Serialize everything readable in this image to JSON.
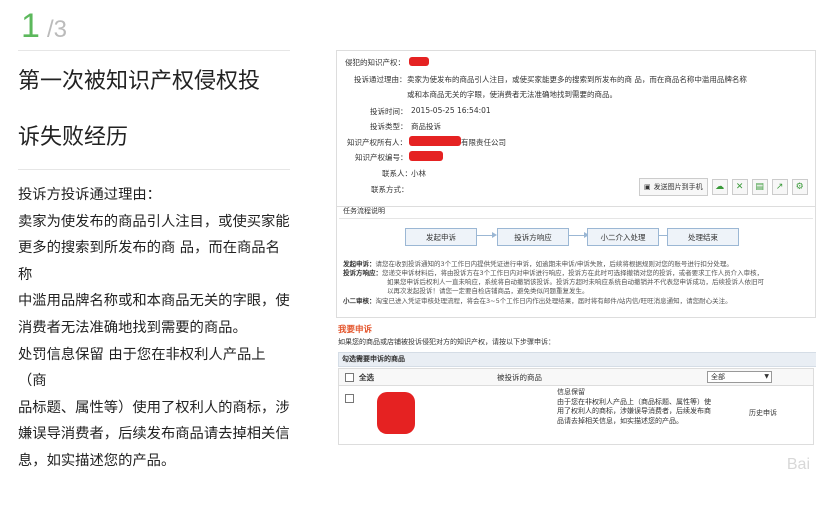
{
  "step": {
    "current": "1",
    "total": "/3"
  },
  "title_line1": "第一次被知识产权侵权投",
  "title_line2": "诉失败经历",
  "body": [
    "投诉方投诉通过理由：",
    "卖家为使发布的商品引人注目，或使买家能",
    "更多的搜索到所发布的商 品，而在商品名称",
    "中滥用品牌名称或和本商品无关的字眼，使",
    "消费者无法准确地找到需要的商品。",
    "处罚信息保留 由于您在非权利人产品上（商",
    "品标题、属性等）使用了权利人的商标，涉",
    "嫌误导消费者，后续发布商品请去掉相关信",
    "息，如实描述您的产品。"
  ],
  "screenshot": {
    "ip_label": "侵犯的知识产权：",
    "reason_label": "投诉通过理由：",
    "reason_line1": "卖家为使发布的商品引人注目，或使买家能更多的搜索到所发布的商 品，而在商品名称中滥用品牌名称",
    "reason_line2": "或和本商品无关的字眼，使消费者无法准确地找到需要的商品。",
    "time_label": "投诉时间：",
    "time_value": "2015-05-25 16:54:01",
    "type_label": "投诉类型：",
    "type_value": "商品投诉",
    "owner_label": "知识产权所有人：",
    "owner_suffix": "有限责任公司",
    "ipno_label": "知识产权编号：",
    "contact_label": "联系人：",
    "contact_value": "小林",
    "contact_way_label": "联系方式：",
    "send_phone": "发送图片到手机",
    "flow_title": "任务流程说明",
    "flow_steps": [
      "发起申诉",
      "投诉方响应",
      "小二介入处理",
      "处理结束"
    ],
    "desc1_label": "发起申诉：",
    "desc1_text": "请您在收到投诉通知的3个工作日内提供凭证进行申诉，如逾期未申诉/申诉失败，后续将根据规则对您的账号进行扣分处理。",
    "desc2_label": "投诉方响应：",
    "desc2_line1": "您递交申诉材料后，将由投诉方在3个工作日内对申诉进行响应，投诉方在此时可选择撤销对您的投诉，或者要求工作人员介入审核，",
    "desc2_line2": "如果您申诉后权利人一直未响应，系统将自动撤销该投诉。投诉方超时未响应系统自动撤销并不代表您申诉成功，后续投诉人依旧可",
    "desc2_line3": "以再次发起投诉！请您一定要自检店铺商品，避免类似问题重复发生。",
    "desc3_label": "小二审核：",
    "desc3_text": "淘宝已进入凭证审核处理流程，将会在3~5个工作日内作出处理结果，届时将有邮件/站内信/旺旺消息通知，请您耐心关注。",
    "appeal_title": "我要申诉",
    "appeal_desc": "如果您的商品或店铺被投诉侵犯对方的知识产权，请按以下步骤申诉：",
    "select_label": "勾选需要申诉的商品",
    "select_all": "全选",
    "col_goods": "被投诉的商品",
    "dropdown": "全部",
    "penalty_line1": "信息保留",
    "penalty_line2": "由于您在非权利人产品上（商品标题、属性等）使",
    "penalty_line3": "用了权利人的商标，涉嫌误导消费者，后续发布商",
    "penalty_line4": "品请去掉相关信息，如实描述您的产品。",
    "history": "历史申诉",
    "watermark": "Bai"
  },
  "colors": {
    "accent": "#5cb85c",
    "redact": "#e52222",
    "appeal": "#e4572e"
  }
}
